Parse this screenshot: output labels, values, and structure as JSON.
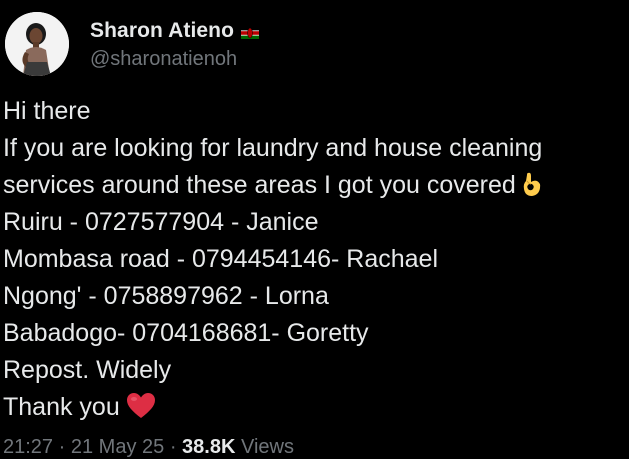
{
  "user": {
    "display_name": "Sharon Atieno",
    "flag": "kenya-flag-icon",
    "handle": "@sharonatienoh",
    "avatar": "avatar-photo"
  },
  "tweet": {
    "lines": [
      "Hi there",
      "If you are looking for laundry and house cleaning",
      "services around these areas I got you covered",
      "Ruiru - 0727577904 - Janice",
      "Mombasa road - 0794454146- Rachael",
      "Ngong' - 0758897962 - Lorna",
      "Babadogo-  0704168681- Goretty",
      "Repost. Widely",
      "Thank you"
    ],
    "emoji_ok": "ok-hand-emoji",
    "emoji_heart": "red-heart-emoji"
  },
  "meta": {
    "time": "21:27",
    "separator": "·",
    "date": "21 May 25",
    "views_count": "38.8K",
    "views_label": "Views"
  },
  "colors": {
    "background": "#000000",
    "text": "#e7e9ea",
    "secondary": "#71767b",
    "heart": "#f91880",
    "ok_hand": "#ffcc4d"
  }
}
